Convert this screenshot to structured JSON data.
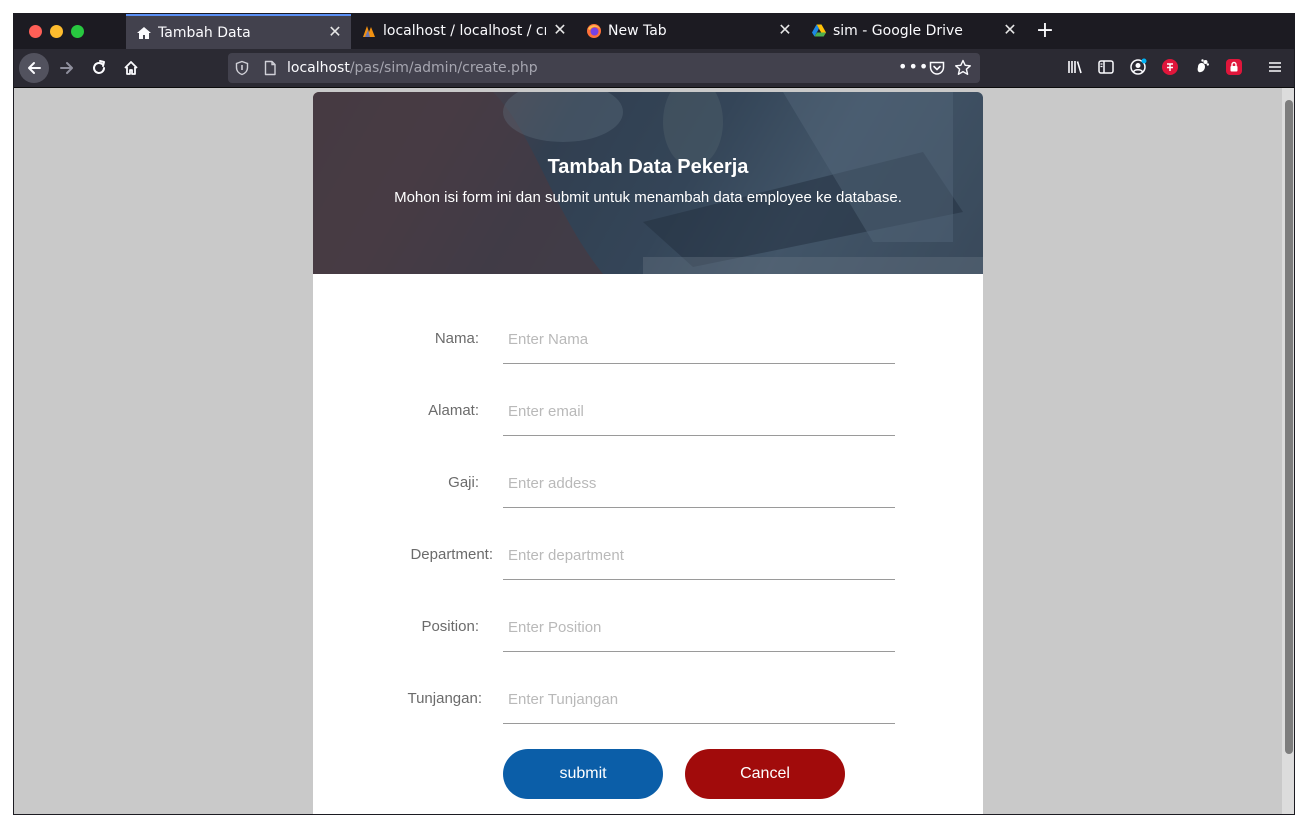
{
  "browser": {
    "tabs": [
      {
        "label": "Tambah Data",
        "icon": "house-icon",
        "active": true
      },
      {
        "label": "localhost / localhost / crud",
        "icon": "phpmyadmin-icon",
        "active": false
      },
      {
        "label": "New Tab",
        "icon": "firefox-icon",
        "active": false
      },
      {
        "label": "sim - Google Drive",
        "icon": "google-drive-icon",
        "active": false
      }
    ],
    "url": {
      "host": "localhost",
      "path": "/pas/sim/admin/create.php"
    }
  },
  "page": {
    "title": "Tambah Data Pekerja",
    "subtitle": "Mohon isi form ini dan submit untuk menambah data employee ke database.",
    "fields": [
      {
        "label": "Nama:",
        "placeholder": "Enter Nama"
      },
      {
        "label": "Alamat:",
        "placeholder": "Enter email"
      },
      {
        "label": "Gaji:",
        "placeholder": "Enter addess"
      },
      {
        "label": "Department:",
        "placeholder": "Enter department"
      },
      {
        "label": "Position:",
        "placeholder": "Enter Position"
      },
      {
        "label": "Tunjangan:",
        "placeholder": "Enter Tunjangan"
      }
    ],
    "submit_label": "submit",
    "cancel_label": "Cancel"
  },
  "colors": {
    "submit": "#0b5ea8",
    "cancel": "#a10b0b",
    "active_tab_accent": "#5a8ff4"
  }
}
